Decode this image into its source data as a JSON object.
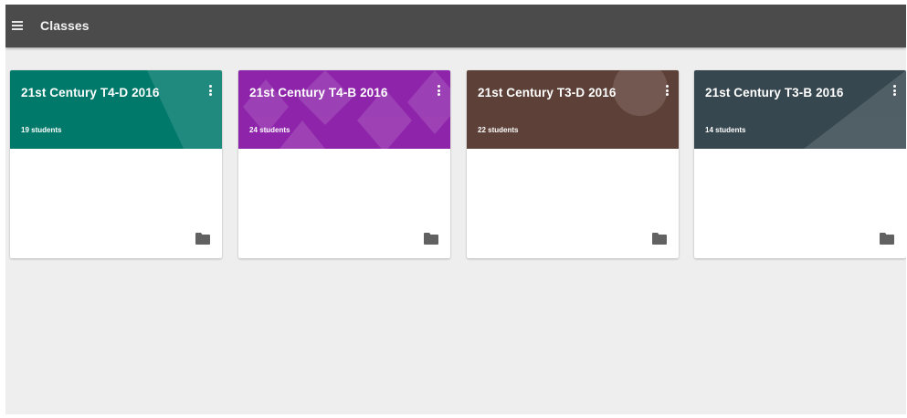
{
  "topbar": {
    "title": "Classes",
    "menu_icon": "hamburger-menu-icon",
    "background": "#4b4b4b"
  },
  "classes": [
    {
      "title": "21st Century T4-D 2016",
      "students": "19 students",
      "color": "#00796b",
      "more_icon": "more-vert-icon",
      "folder_icon": "folder-icon"
    },
    {
      "title": "21st Century T4-B 2016",
      "students": "24 students",
      "color": "#8e24aa",
      "more_icon": "more-vert-icon",
      "folder_icon": "folder-icon"
    },
    {
      "title": "21st Century T3-D 2016",
      "students": "22 students",
      "color": "#5d4037",
      "more_icon": "more-vert-icon",
      "folder_icon": "folder-icon"
    },
    {
      "title": "21st Century T3-B 2016",
      "students": "14 students",
      "color": "#37474f",
      "more_icon": "more-vert-icon",
      "folder_icon": "folder-icon"
    }
  ]
}
